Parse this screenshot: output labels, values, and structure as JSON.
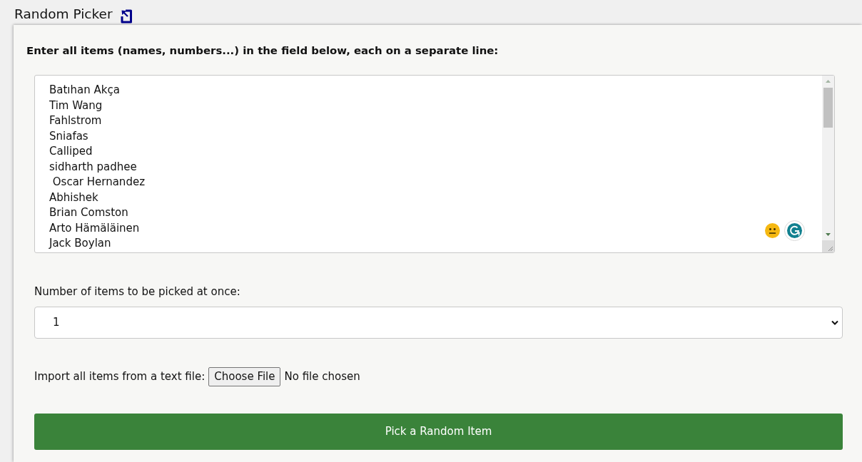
{
  "page": {
    "title": "Random Picker"
  },
  "form": {
    "instructions": "Enter all items (names, numbers...) in the field below, each on a separate line:",
    "items": [
      "Batıhan Akça",
      "Tim Wang",
      "Fahlstrom",
      "Sniafas",
      "Calliped",
      "sidharth padhee",
      " Oscar Hernandez",
      "Abhishek",
      "Brian Comston",
      "Arto Hämäläinen",
      "Jack Boylan"
    ],
    "count_label": "Number of items to be picked at once:",
    "count_value": "1",
    "import_label": "Import all items from a text file:",
    "file_button": "Choose File",
    "file_status": "No file chosen",
    "pick_button": "Pick a Random Item"
  }
}
